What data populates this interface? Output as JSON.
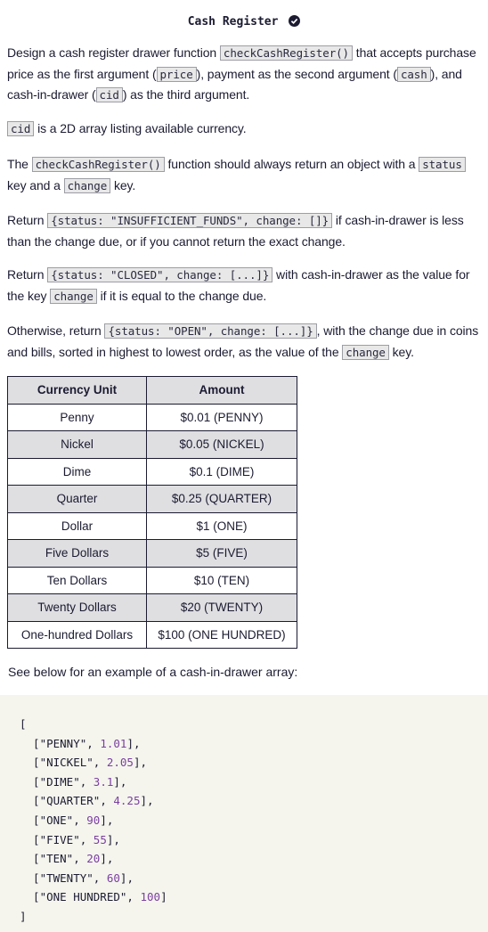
{
  "title": "Cash Register",
  "p1": {
    "t1": "Design a cash register drawer function ",
    "c1": "checkCashRegister()",
    "t2": " that accepts purchase price as the first argument (",
    "c2": "price",
    "t3": "), payment as the second argument (",
    "c3": "cash",
    "t4": "), and cash-in-drawer (",
    "c4": "cid",
    "t5": ") as the third argument."
  },
  "p2": {
    "c1": "cid",
    "t1": " is a 2D array listing available currency."
  },
  "p3": {
    "t1": "The ",
    "c1": "checkCashRegister()",
    "t2": " function should always return an object with a ",
    "c2": "status",
    "t3": " key and a ",
    "c3": "change",
    "t4": " key."
  },
  "p4": {
    "t1": "Return ",
    "c1": "{status: \"INSUFFICIENT_FUNDS\", change: []}",
    "t2": " if cash-in-drawer is less than the change due, or if you cannot return the exact change."
  },
  "p5": {
    "t1": "Return ",
    "c1": "{status: \"CLOSED\", change: [...]}",
    "t2": " with cash-in-drawer as the value for the key ",
    "c2": "change",
    "t3": " if it is equal to the change due."
  },
  "p6": {
    "t1": "Otherwise, return ",
    "c1": "{status: \"OPEN\", change: [...]}",
    "t2": ", with the change due in coins and bills, sorted in highest to lowest order, as the value of the ",
    "c2": "change",
    "t3": " key."
  },
  "table": {
    "headers": [
      "Currency Unit",
      "Amount"
    ],
    "rows": [
      [
        "Penny",
        "$0.01 (PENNY)"
      ],
      [
        "Nickel",
        "$0.05 (NICKEL)"
      ],
      [
        "Dime",
        "$0.1 (DIME)"
      ],
      [
        "Quarter",
        "$0.25 (QUARTER)"
      ],
      [
        "Dollar",
        "$1 (ONE)"
      ],
      [
        "Five Dollars",
        "$5 (FIVE)"
      ],
      [
        "Ten Dollars",
        "$10 (TEN)"
      ],
      [
        "Twenty Dollars",
        "$20 (TWENTY)"
      ],
      [
        "One-hundred Dollars",
        "$100 (ONE HUNDRED)"
      ]
    ]
  },
  "example_note": "See below for an example of a cash-in-drawer array:",
  "code": {
    "open": "[",
    "lines": [
      [
        "\"PENNY\"",
        "1.01"
      ],
      [
        "\"NICKEL\"",
        "2.05"
      ],
      [
        "\"DIME\"",
        "3.1"
      ],
      [
        "\"QUARTER\"",
        "4.25"
      ],
      [
        "\"ONE\"",
        "90"
      ],
      [
        "\"FIVE\"",
        "55"
      ],
      [
        "\"TEN\"",
        "20"
      ],
      [
        "\"TWENTY\"",
        "60"
      ],
      [
        "\"ONE HUNDRED\"",
        "100"
      ]
    ],
    "close": "]"
  },
  "colors": {
    "code_bg": "#f5f5ee",
    "number": "#7b3fa0",
    "check": "#1b1b32"
  },
  "icons": {
    "title_badge": "check-circle-icon"
  }
}
